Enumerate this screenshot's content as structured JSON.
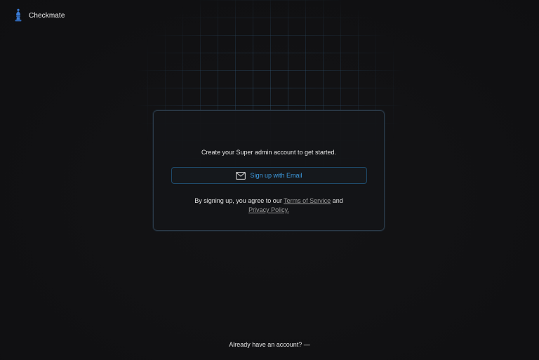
{
  "brand": {
    "name": "Checkmate",
    "logo_icon": "chess-bishop-icon",
    "logo_color": "#3a7bd5"
  },
  "card": {
    "heading": "Create your Super admin account to get started.",
    "email_button": {
      "label": "Sign up with Email",
      "icon": "mail-icon",
      "accent_color": "#3d9be0"
    },
    "legal": {
      "prefix": "By signing up, you agree to our",
      "terms_link": "Terms of Service",
      "conjunction": "and",
      "privacy_link": "Privacy Policy."
    }
  },
  "footer": {
    "text": "Already have an account? —"
  }
}
